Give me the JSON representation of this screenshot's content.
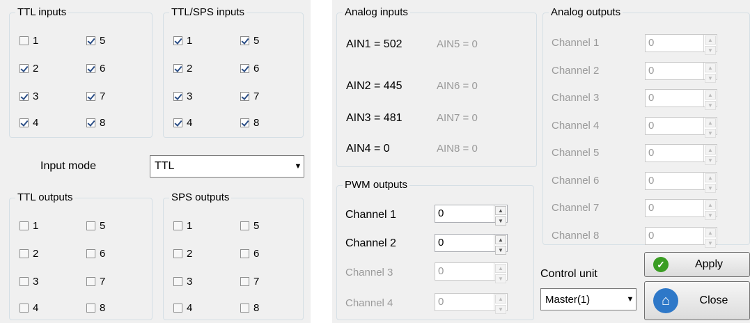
{
  "left": {
    "ttl_inputs": {
      "title": "TTL inputs",
      "items": [
        {
          "label": "1",
          "checked": false
        },
        {
          "label": "5",
          "checked": true
        },
        {
          "label": "2",
          "checked": true
        },
        {
          "label": "6",
          "checked": true
        },
        {
          "label": "3",
          "checked": true
        },
        {
          "label": "7",
          "checked": true
        },
        {
          "label": "4",
          "checked": true
        },
        {
          "label": "8",
          "checked": true
        }
      ]
    },
    "ttl_sps_inputs": {
      "title": "TTL/SPS inputs",
      "items": [
        {
          "label": "1",
          "checked": true
        },
        {
          "label": "5",
          "checked": true
        },
        {
          "label": "2",
          "checked": true
        },
        {
          "label": "6",
          "checked": true
        },
        {
          "label": "3",
          "checked": true
        },
        {
          "label": "7",
          "checked": true
        },
        {
          "label": "4",
          "checked": true
        },
        {
          "label": "8",
          "checked": true
        }
      ]
    },
    "input_mode": {
      "label": "Input mode",
      "value": "TTL"
    },
    "ttl_outputs": {
      "title": "TTL outputs",
      "items": [
        {
          "label": "1",
          "checked": false
        },
        {
          "label": "5",
          "checked": false
        },
        {
          "label": "2",
          "checked": false
        },
        {
          "label": "6",
          "checked": false
        },
        {
          "label": "3",
          "checked": false
        },
        {
          "label": "7",
          "checked": false
        },
        {
          "label": "4",
          "checked": false
        },
        {
          "label": "8",
          "checked": false
        }
      ]
    },
    "sps_outputs": {
      "title": "SPS outputs",
      "items": [
        {
          "label": "1",
          "checked": false
        },
        {
          "label": "5",
          "checked": false
        },
        {
          "label": "2",
          "checked": false
        },
        {
          "label": "6",
          "checked": false
        },
        {
          "label": "3",
          "checked": false
        },
        {
          "label": "7",
          "checked": false
        },
        {
          "label": "4",
          "checked": false
        },
        {
          "label": "8",
          "checked": false
        }
      ]
    }
  },
  "analog_inputs": {
    "title": "Analog inputs",
    "values": [
      "AIN1 = 502",
      "AIN2 = 445",
      "AIN3 = 481",
      "AIN4 = 0"
    ],
    "values_dim": [
      "AIN5 = 0",
      "AIN6 = 0",
      "AIN7 = 0",
      "AIN8 = 0"
    ]
  },
  "pwm_outputs": {
    "title": "PWM outputs",
    "channels": [
      {
        "label": "Channel 1",
        "value": "0",
        "enabled": true
      },
      {
        "label": "Channel 2",
        "value": "0",
        "enabled": true
      },
      {
        "label": "Channel 3",
        "value": "0",
        "enabled": false
      },
      {
        "label": "Channel 4",
        "value": "0",
        "enabled": false
      }
    ]
  },
  "analog_outputs": {
    "title": "Analog outputs",
    "channels": [
      {
        "label": "Channel 1",
        "value": "0"
      },
      {
        "label": "Channel 2",
        "value": "0"
      },
      {
        "label": "Channel 3",
        "value": "0"
      },
      {
        "label": "Channel 4",
        "value": "0"
      },
      {
        "label": "Channel 5",
        "value": "0"
      },
      {
        "label": "Channel 6",
        "value": "0"
      },
      {
        "label": "Channel 7",
        "value": "0"
      },
      {
        "label": "Channel 8",
        "value": "0"
      }
    ]
  },
  "control_unit": {
    "label": "Control unit",
    "value": "Master(1)"
  },
  "buttons": {
    "apply": "Apply",
    "close": "Close"
  },
  "colors": {
    "apply_icon": "#3a9d23",
    "close_icon": "#2e78c8"
  }
}
